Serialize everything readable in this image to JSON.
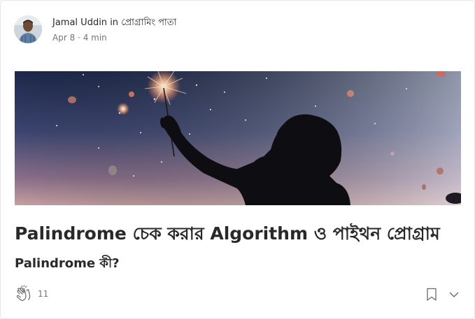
{
  "post": {
    "author": "Jamal Uddin",
    "in_word": "in",
    "publication": "প্রোগ্রামিং পাতা",
    "date": "Apr 8",
    "separator": "·",
    "read_time": "4 min",
    "title": "Palindrome চেক করার Algorithm ও পাইথন প্রোগ্রাম",
    "subtitle": "Palindrome কী?",
    "claps": "11"
  },
  "colors": {
    "text_primary": "#292929",
    "text_secondary": "#757575",
    "card_border": "#e6e6e6"
  },
  "icons": {
    "clap": "clap-icon",
    "bookmark": "bookmark-icon",
    "more": "chevron-down-icon"
  }
}
